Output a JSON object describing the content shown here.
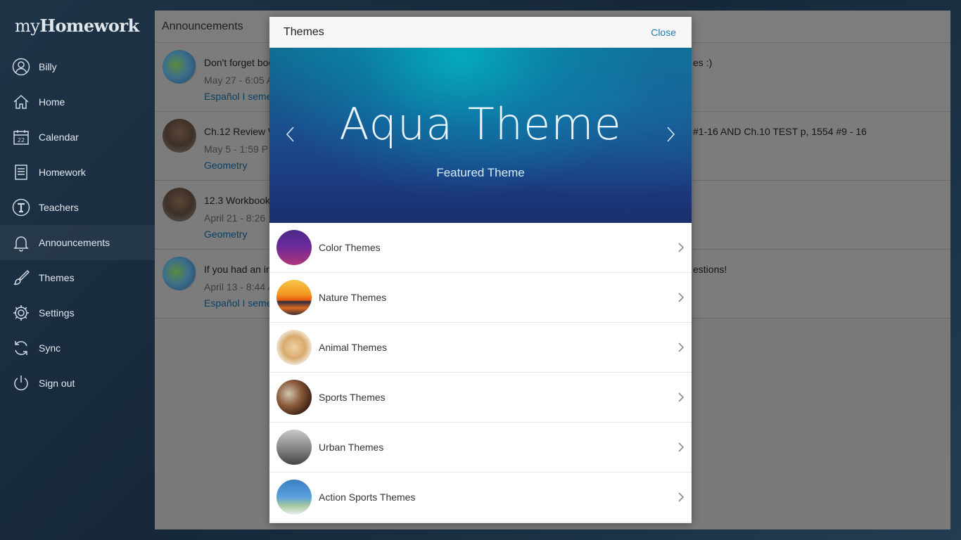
{
  "app": {
    "logo_main": "my",
    "logo_bold": "Homework"
  },
  "sidebar": {
    "items": [
      {
        "label": "Billy",
        "icon": "user-icon"
      },
      {
        "label": "Home",
        "icon": "home-icon"
      },
      {
        "label": "Calendar",
        "icon": "calendar-icon"
      },
      {
        "label": "Homework",
        "icon": "document-icon"
      },
      {
        "label": "Teachers",
        "icon": "teacher-icon"
      },
      {
        "label": "Announcements",
        "icon": "bell-icon"
      },
      {
        "label": "Themes",
        "icon": "brush-icon"
      },
      {
        "label": "Settings",
        "icon": "gear-icon"
      },
      {
        "label": "Sync",
        "icon": "sync-icon"
      },
      {
        "label": "Sign out",
        "icon": "power-icon"
      }
    ],
    "calendar_day": "22"
  },
  "main": {
    "title": "Announcements",
    "announcements": [
      {
        "title": "Don't forget boo",
        "date": "May 27 - 6:05 A",
        "class": "Español I seme",
        "rest": "es :)"
      },
      {
        "title": "Ch.12 Review W",
        "date": "May 5 - 1:59 P",
        "class": "Geometry",
        "rest": "#1-16 AND Ch.10 TEST p, 1554 #9 - 16"
      },
      {
        "title": "12.3 Workbook",
        "date": "April 21 - 8:26",
        "class": "Geometry",
        "rest": ""
      },
      {
        "title": "If you had an in",
        "date": "April 13 - 8:44 A",
        "class": "Español I seme",
        "rest": "estions!"
      }
    ]
  },
  "modal": {
    "title": "Themes",
    "close_label": "Close",
    "banner": {
      "title": "Aqua Theme",
      "subtitle": "Featured Theme"
    },
    "themes": [
      {
        "label": "Color Themes"
      },
      {
        "label": "Nature Themes"
      },
      {
        "label": "Animal Themes"
      },
      {
        "label": "Sports Themes"
      },
      {
        "label": "Urban Themes"
      },
      {
        "label": "Action Sports Themes"
      }
    ]
  },
  "colors": {
    "accent": "#1f7bb0",
    "link": "#0b3f5f"
  }
}
